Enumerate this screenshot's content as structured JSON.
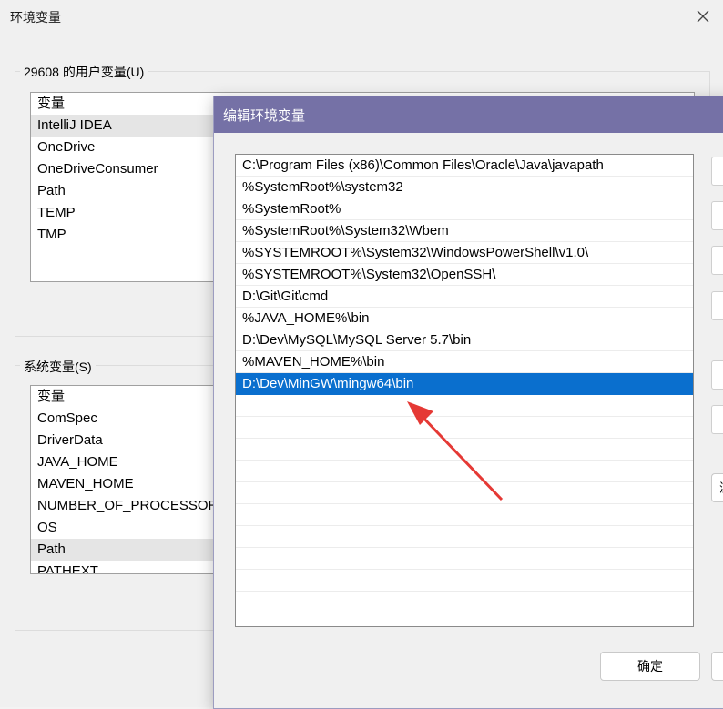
{
  "background_dialog": {
    "title": "环境变量",
    "user_vars": {
      "group_label": "29608 的用户变量(U)",
      "header": "变量",
      "rows": [
        "IntelliJ IDEA",
        "OneDrive",
        "OneDriveConsumer",
        "Path",
        "TEMP",
        "TMP"
      ],
      "selected_index": 0
    },
    "system_vars": {
      "group_label": "系统变量(S)",
      "header": "变量",
      "rows": [
        "ComSpec",
        "DriverData",
        "JAVA_HOME",
        "MAVEN_HOME",
        "NUMBER_OF_PROCESSORS",
        "OS",
        "Path",
        "PATHEXT"
      ],
      "selected_index": 6
    }
  },
  "edit_dialog": {
    "title": "编辑环境变量",
    "paths": [
      "C:\\Program Files (x86)\\Common Files\\Oracle\\Java\\javapath",
      "%SystemRoot%\\system32",
      "%SystemRoot%",
      "%SystemRoot%\\System32\\Wbem",
      "%SYSTEMROOT%\\System32\\WindowsPowerShell\\v1.0\\",
      "%SYSTEMROOT%\\System32\\OpenSSH\\",
      "D:\\Git\\Git\\cmd",
      "%JAVA_HOME%\\bin",
      "D:\\Dev\\MySQL\\MySQL Server 5.7\\bin",
      "%MAVEN_HOME%\\bin",
      "D:\\Dev\\MinGW\\mingw64\\bin"
    ],
    "selected_index": 10,
    "ok_label": "确定",
    "browse_partial_label": "浏"
  },
  "colors": {
    "titlebar": "#7571a6",
    "selection": "#0a6fce",
    "annotation_arrow": "#e53935"
  }
}
